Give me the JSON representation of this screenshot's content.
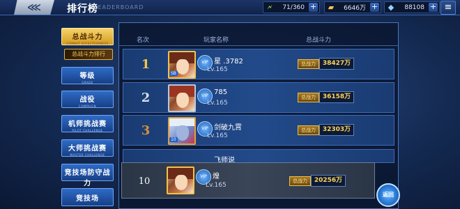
{
  "header": {
    "back_glyph": "⋘",
    "title": "排行榜",
    "subtitle": "LEADERBOARD",
    "resources": [
      {
        "icon": "energy-icon",
        "glyph": "🗲",
        "value": "71/360"
      },
      {
        "icon": "gold-icon",
        "glyph": "▰",
        "value": "6646万"
      },
      {
        "icon": "diamond-icon",
        "glyph": "◆",
        "value": "88108"
      }
    ],
    "settings_glyph": "≡"
  },
  "sidebar": {
    "tabs": [
      {
        "label": "总战斗力",
        "sub": "COMBAT EFFECTIVENESS",
        "active": true
      },
      {
        "label": "等级",
        "sub": "GRADE"
      },
      {
        "label": "战役",
        "sub": "CAMPAIGN"
      },
      {
        "label": "机师挑战赛",
        "sub": "PILOT CHALLENGE"
      },
      {
        "label": "大师挑战赛",
        "sub": "MASTER CHALLENGE"
      },
      {
        "label": "竞技场防守战力",
        "sub": "ARENA DEFENSIVE COMBAT POWER"
      },
      {
        "label": "竞技场",
        "sub": ""
      }
    ],
    "subtab": "总战斗力排行"
  },
  "table": {
    "headers": [
      "名次",
      "玩家名称",
      "总战斗力"
    ],
    "power_label": "总战力",
    "rows": [
      {
        "rank": "1",
        "name": "星 .3782",
        "vip": "SB",
        "level": "Lv.165",
        "power": "38427万"
      },
      {
        "rank": "2",
        "name": "785",
        "vip": "",
        "level": "Lv.165",
        "power": "36158万"
      },
      {
        "rank": "3",
        "name": "剑破九霄",
        "vip": "10",
        "level": "Lv.165",
        "power": "32303万"
      }
    ],
    "partial_row": {
      "name": "飞师说"
    },
    "mine": {
      "rank": "10",
      "name": "煌",
      "level": "Lv.165",
      "power": "20256万"
    }
  },
  "footer": {
    "back_label": "返回"
  }
}
